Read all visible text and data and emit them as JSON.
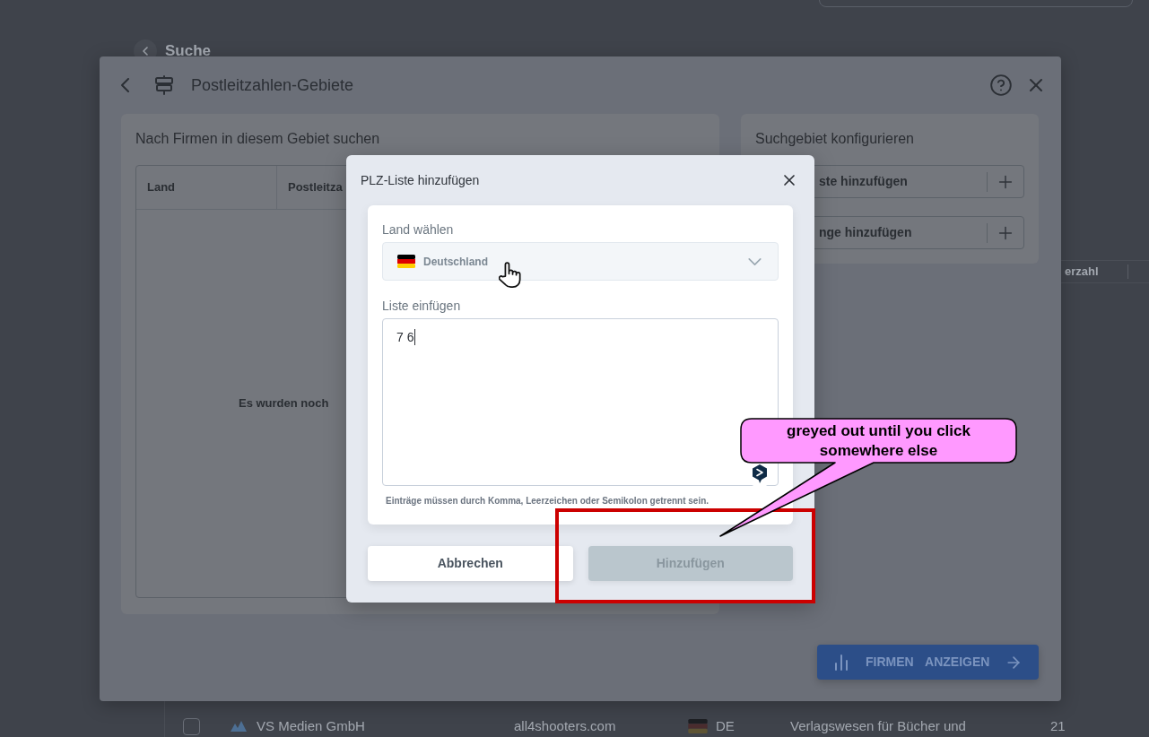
{
  "page": {
    "heading": "Suche",
    "column_header": "erzahl",
    "row": {
      "checked": false,
      "company": "VS Medien GmbH",
      "website": "all4shooters.com",
      "country": "DE",
      "industry": "Verlagswesen für Bücher und",
      "count": "21"
    }
  },
  "modal": {
    "title": "Postleitzahlen-Gebiete",
    "results": {
      "title": "Nach Firmen in diesem Gebiet suchen",
      "columns": [
        "Land",
        "Postleitza"
      ],
      "empty_text": "Es wurden noch"
    },
    "configure": {
      "title": "Suchgebiet konfigurieren",
      "actions": [
        "ste hinzufügen",
        "nge hinzufügen"
      ]
    },
    "submit": "FIRMEN ANZEIGEN"
  },
  "dialog": {
    "title": "PLZ-Liste hinzufügen",
    "country_label": "Land wählen",
    "country": "Deutschland",
    "list_label": "Liste einfügen",
    "list_value": "7 6",
    "hint": "Einträge müssen durch Komma, Leerzeichen oder Semikolon getrennt sein.",
    "buttons": [
      {
        "label": "Abbrechen",
        "kind": "secondary",
        "disabled": false
      },
      {
        "label": "Hinzufügen",
        "kind": "primary",
        "disabled": true
      }
    ]
  },
  "annotation": {
    "text": "greyed out until you click somewhere else"
  }
}
